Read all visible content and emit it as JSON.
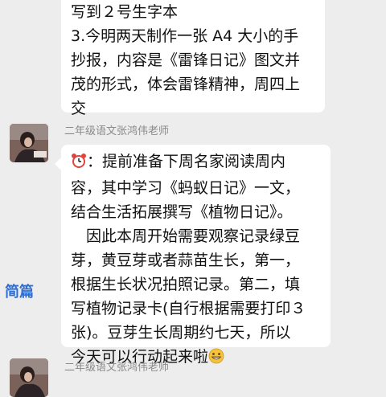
{
  "messages": [
    {
      "lines": [
        "写到２号生字本",
        "3.今明两天制作一张 A4 大小的手",
        "抄报，内容是《雷锋日记》图文并",
        "茂的形式，体会雷锋精神，周四上",
        "交"
      ]
    },
    {
      "sender": "二年级语文张鸿伟老师",
      "lines": [
        "：提前准备下周名家阅读周内",
        "容，其中学习《蚂蚁日记》一文，",
        "结合生活拓展撰写《植物日记》。",
        "　因此本周开始需要观察记录绿豆",
        "芽，黄豆芽或者蒜苗生长，第一，",
        "根据生长状况拍照记录。第二，填",
        "写植物记录卡(自行根据需要打印３",
        "张)。豆芽生长周期约七天，所以",
        "今天可以行动起来啦"
      ],
      "leading_icon": "alarm-clock-icon",
      "trailing_icon": "grinning-face-icon"
    },
    {
      "sender": "二年级语文张鸿伟老师"
    }
  ],
  "side_tag": "简篇",
  "colors": {
    "background": "#ededed",
    "bubble": "#ffffff",
    "sender_text": "#8a8a8a",
    "side_tag": "#2c6fd6"
  }
}
